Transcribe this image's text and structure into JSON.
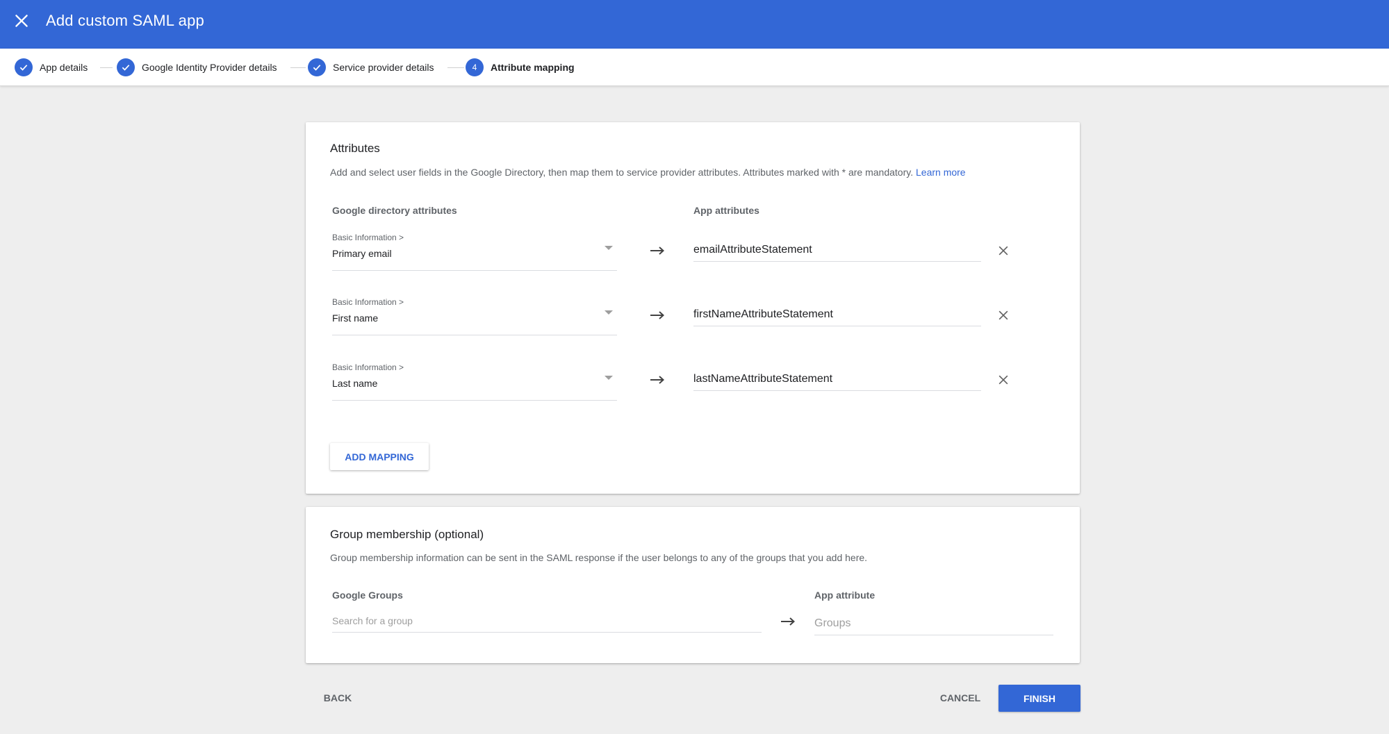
{
  "header": {
    "title": "Add custom SAML app",
    "close_icon": "close-icon"
  },
  "stepper": {
    "steps": [
      {
        "label": "App details",
        "status": "complete",
        "icon": "check-icon"
      },
      {
        "label": "Google Identity Provider details",
        "status": "complete",
        "icon": "check-icon"
      },
      {
        "label": "Service provider details",
        "status": "complete",
        "icon": "check-icon"
      },
      {
        "label": "Attribute mapping",
        "number": "4",
        "status": "current"
      }
    ]
  },
  "attributes": {
    "title": "Attributes",
    "description": "Add and select user fields in the Google Directory, then map them to service provider attributes. Attributes marked with * are mandatory.",
    "learn_more": "Learn more",
    "col_directory": "Google directory attributes",
    "col_app": "App attributes",
    "mappings": [
      {
        "category": "Basic Information >",
        "field": "Primary email",
        "app_attribute": "emailAttributeStatement"
      },
      {
        "category": "Basic Information >",
        "field": "First name",
        "app_attribute": "firstNameAttributeStatement"
      },
      {
        "category": "Basic Information >",
        "field": "Last name",
        "app_attribute": "lastNameAttributeStatement"
      }
    ],
    "add_mapping": "ADD MAPPING"
  },
  "groups": {
    "title": "Group membership (optional)",
    "description": "Group membership information can be sent in the SAML response if the user belongs to any of the groups that you add here.",
    "col_groups": "Google Groups",
    "col_app": "App attribute",
    "search_placeholder": "Search for a group",
    "app_placeholder": "Groups"
  },
  "footer": {
    "back": "BACK",
    "cancel": "CANCEL",
    "finish": "FINISH"
  },
  "colors": {
    "primary": "#3367d6",
    "background": "#eeeeee"
  }
}
